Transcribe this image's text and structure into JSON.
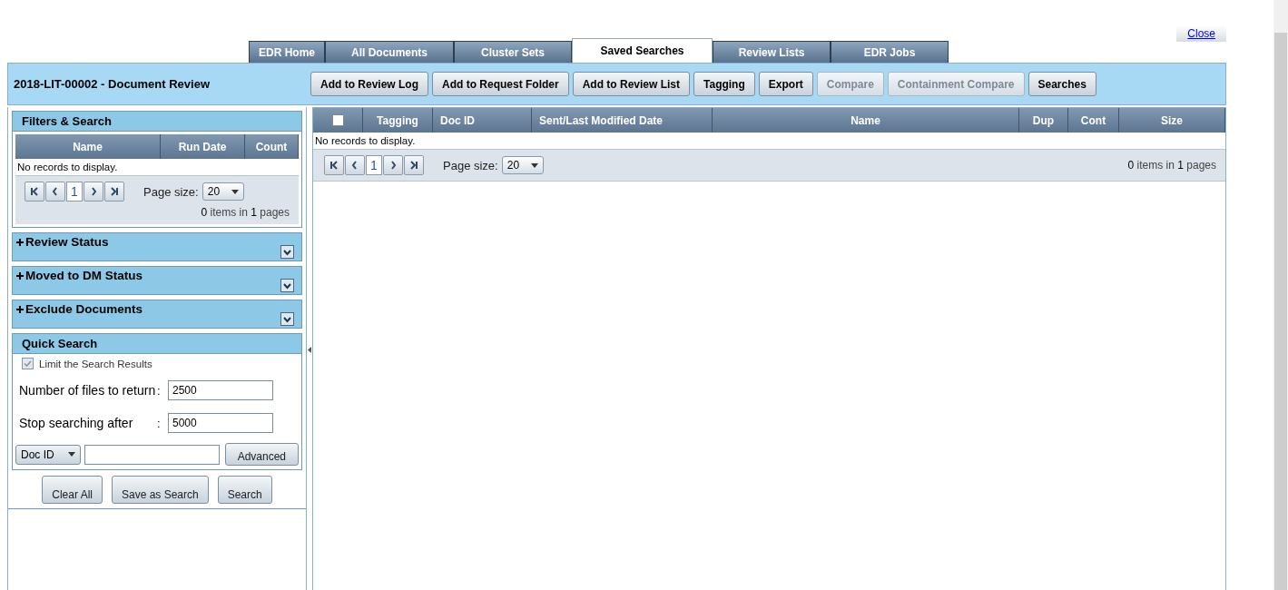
{
  "close_link": "Close",
  "tabs": [
    {
      "label": "EDR Home",
      "selected": false
    },
    {
      "label": "All Documents",
      "selected": false
    },
    {
      "label": "Cluster Sets",
      "selected": false
    },
    {
      "label": "Saved Searches",
      "selected": true
    },
    {
      "label": "Review Lists",
      "selected": false
    },
    {
      "label": "EDR Jobs",
      "selected": false
    }
  ],
  "header": {
    "title": "2018-LIT-00002 - Document Review",
    "buttons": [
      {
        "label": "Add to Review Log",
        "disabled": false
      },
      {
        "label": "Add to Request Folder",
        "disabled": false
      },
      {
        "label": "Add to Review List",
        "disabled": false
      },
      {
        "label": "Tagging",
        "disabled": false
      },
      {
        "label": "Export",
        "disabled": false
      },
      {
        "label": "Compare",
        "disabled": true
      },
      {
        "label": "Containment Compare",
        "disabled": true
      },
      {
        "label": "Searches",
        "disabled": false
      }
    ]
  },
  "filters": {
    "title": "Filters & Search",
    "columns": [
      "Name",
      "Run Date",
      "Count"
    ],
    "empty_text": "No records to display.",
    "pager": {
      "page": "1",
      "page_size_label": "Page size:",
      "page_size": "20",
      "summary": "**0** items in **1** pages"
    }
  },
  "sections": [
    {
      "label": "Review Status",
      "expanded": false
    },
    {
      "label": "Moved to DM Status",
      "expanded": false
    },
    {
      "label": "Exclude Documents",
      "expanded": false
    }
  ],
  "quick_search": {
    "title": "Quick Search",
    "limit": {
      "label": "Limit the Search Results",
      "checked": true,
      "disabled": true
    },
    "fields": [
      {
        "label": "Number of files to return",
        "separator": ":",
        "value": "2500"
      },
      {
        "label": "Stop searching after",
        "separator": ":",
        "value": "5000"
      }
    ],
    "field_dropdown": "Doc ID",
    "advanced_button": "Advanced"
  },
  "actions": [
    "Clear All",
    "Save as Search",
    "Search"
  ],
  "grid": {
    "select_all_checked": false,
    "columns": [
      "Tagging",
      "Doc ID",
      "Sent/Last Modified Date",
      "Name",
      "Dup",
      "Cont",
      "Size"
    ],
    "empty_text": "No records to display.",
    "pager": {
      "page": "1",
      "page_size_label": "Page size:",
      "page_size": "20",
      "summary": "**0** items in **1** pages"
    }
  }
}
